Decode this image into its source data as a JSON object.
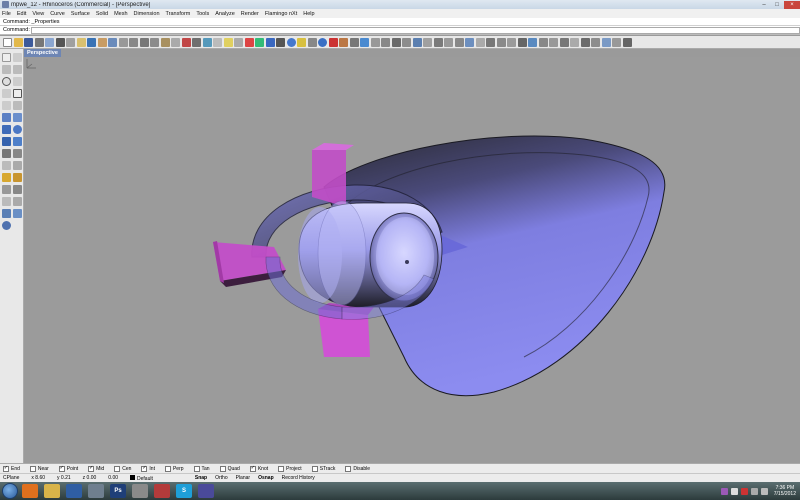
{
  "window": {
    "title": "mpwe_12 - Rhinoceros (Commercial) - [Perspective]",
    "controls": [
      "–",
      "□",
      "×"
    ]
  },
  "menu": [
    "File",
    "Edit",
    "View",
    "Curve",
    "Surface",
    "Solid",
    "Mesh",
    "Dimension",
    "Transform",
    "Tools",
    "Analyze",
    "Render",
    "Flamingo nXt",
    "Help"
  ],
  "command": {
    "history": "Command: _Properties",
    "prompt_label": "Command:",
    "value": ""
  },
  "viewport": {
    "tab_label": "Perspective"
  },
  "osnaps": [
    {
      "label": "End",
      "checked": true
    },
    {
      "label": "Near",
      "checked": false
    },
    {
      "label": "Point",
      "checked": true
    },
    {
      "label": "Mid",
      "checked": true
    },
    {
      "label": "Cen",
      "checked": false
    },
    {
      "label": "Int",
      "checked": true
    },
    {
      "label": "Perp",
      "checked": false
    },
    {
      "label": "Tan",
      "checked": false
    },
    {
      "label": "Quad",
      "checked": false
    },
    {
      "label": "Knot",
      "checked": true
    },
    {
      "label": "Project",
      "checked": false
    },
    {
      "label": "STrack",
      "checked": false
    },
    {
      "label": "Disable",
      "checked": false
    }
  ],
  "status": {
    "cplane": "CPlane",
    "x": "x 8.60",
    "y": "y 0.21",
    "z": "z 0.00",
    "extra": "0.00",
    "layer": "Default",
    "toggles": [
      {
        "label": "Snap",
        "bold": true
      },
      {
        "label": "Ortho",
        "bold": false
      },
      {
        "label": "Planar",
        "bold": false
      },
      {
        "label": "Osnap",
        "bold": true
      },
      {
        "label": "Record History",
        "bold": false
      }
    ]
  },
  "taskbar": {
    "apps": [
      {
        "name": "firefox",
        "label": "",
        "color": "#e0701e"
      },
      {
        "name": "explorer",
        "label": "",
        "color": "#d9b449"
      },
      {
        "name": "media",
        "label": "",
        "color": "#2f5ea3"
      },
      {
        "name": "rhino",
        "label": "",
        "color": "#6f7f8f"
      },
      {
        "name": "photoshop",
        "label": "Ps",
        "color": "#1f3f78"
      },
      {
        "name": "app-a",
        "label": "",
        "color": "#8a8a8a"
      },
      {
        "name": "app-b",
        "label": "",
        "color": "#b33b3b"
      },
      {
        "name": "skype",
        "label": "S",
        "color": "#1e9fd8"
      },
      {
        "name": "app-c",
        "label": "",
        "color": "#4a4a9a"
      }
    ],
    "time": "7:36 PM",
    "date": "7/15/2012"
  },
  "colors": {
    "body_purple": "#8a8ae6",
    "fin_magenta": "#d050d0",
    "viewport_bg": "#9b9b9b",
    "tab_blue": "#6e86b4"
  }
}
